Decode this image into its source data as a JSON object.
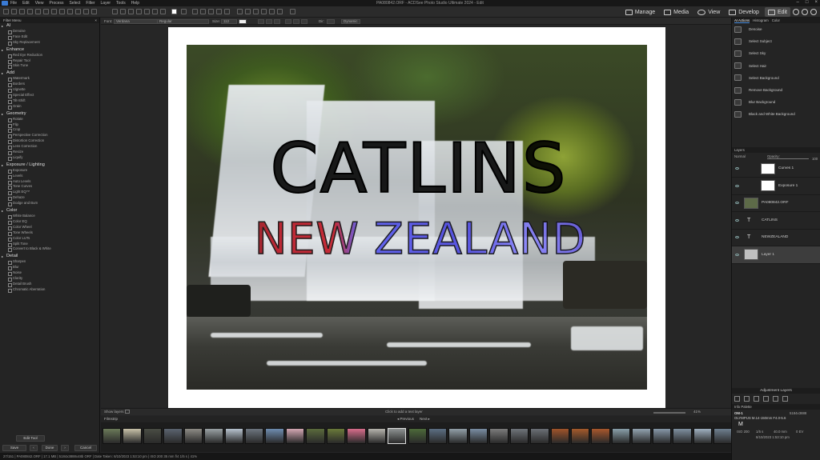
{
  "app": {
    "title": "PA080842.ORF - ACDSee Photo Studio Ultimate 2024 - Edit",
    "menu": [
      "File",
      "Edit",
      "View",
      "Process",
      "Select",
      "Filter",
      "Layer",
      "Tools",
      "Help"
    ],
    "modes": [
      {
        "label": "Manage",
        "icon": "manage-icon",
        "active": false
      },
      {
        "label": "Media",
        "icon": "media-icon",
        "active": false
      },
      {
        "label": "View",
        "icon": "eye-icon",
        "active": false
      },
      {
        "label": "Develop",
        "icon": "develop-icon",
        "active": false
      },
      {
        "label": "Edit",
        "icon": "edit-icon",
        "active": true
      }
    ]
  },
  "filter_menu": {
    "title": "Filter Menu",
    "categories": [
      {
        "name": "AI",
        "items": [
          "Denoise",
          "Face Edit",
          "Sky Replacement"
        ]
      },
      {
        "name": "Enhance",
        "items": [
          "Red Eye Reduction",
          "Repair Tool",
          "Skin Tune"
        ]
      },
      {
        "name": "Add",
        "items": [
          "Watermark",
          "Borders",
          "Vignette",
          "Special Effect",
          "Tilt-Shift",
          "Grain"
        ]
      },
      {
        "name": "Geometry",
        "items": [
          "Rotate",
          "Flip",
          "Crop",
          "Perspective Correction",
          "Distortion Correction",
          "Lens Correction",
          "Resize",
          "Liquify"
        ]
      },
      {
        "name": "Exposure / Lighting",
        "items": [
          "Exposure",
          "Levels",
          "Auto Levels",
          "Tone Curves",
          "Light EQ™",
          "Dehaze",
          "Dodge and Burn"
        ]
      },
      {
        "name": "Color",
        "items": [
          "White Balance",
          "Color EQ",
          "Color Wheel",
          "Tone Wheels",
          "Color LUTs",
          "Split Tone",
          "Convert to Black & White"
        ]
      },
      {
        "name": "Detail",
        "items": [
          "Sharpen",
          "Blur",
          "Noise",
          "Clarity",
          "Detail Brush",
          "Chromatic Aberration"
        ]
      }
    ],
    "edit_tool_label": "Edit Tool",
    "save_label": "Save",
    "done_label": "Done",
    "cancel_label": "Cancel"
  },
  "option_bar": {
    "font_label": "Font:",
    "font_value": "Verdana",
    "style_value": "Regular",
    "size_label": "Size:",
    "size_value": "112",
    "align_label": "Dir:",
    "layout_value": "Dynamic"
  },
  "canvas": {
    "headline": "CATLINS",
    "subline": "NEW ZEALAND",
    "show_layers_label": "Show layers",
    "hint": "Click to add a text layer",
    "zoom": "41%"
  },
  "filmstrip": {
    "title": "Filmstrip",
    "prev_label": "Previous",
    "next_label": "Next",
    "thumb_colors": [
      "#6b7a59",
      "#c8c2a8",
      "#4a4d44",
      "#5b6470",
      "#8e8c86",
      "#9aa2a5",
      "#b7c3cf",
      "#6d7680",
      "#6f8db0",
      "#d4a7b3",
      "#5b6b3d",
      "#6a7a3a",
      "#d86d8c",
      "#b6b4ad",
      "#8e9392",
      "#4d6a3a",
      "#5c6f83",
      "#93a0a8",
      "#7a8ea3",
      "#7c7c7c",
      "#6f747a",
      "#6b7076",
      "#a0542a",
      "#a55a2b",
      "#a8572c",
      "#8aa0aa",
      "#93a3b0",
      "#8798a8",
      "#7f90a0",
      "#9fb0c0",
      "#6f8090"
    ],
    "selected_index": 14
  },
  "ai_actions": {
    "tabs": [
      "AI Actions",
      "Histogram",
      "Color"
    ],
    "items": [
      "Denoise",
      "Select Subject",
      "Select Sky",
      "Select Hair",
      "Select Background",
      "Remove Background",
      "Blur Background",
      "Black and White Background"
    ]
  },
  "layers": {
    "title": "Layers",
    "blend": "Normal",
    "opacity_label": "Opacity:",
    "opacity_value": "100",
    "items": [
      {
        "name": "Curves 1",
        "type": "adjust"
      },
      {
        "name": "Exposure 1",
        "type": "adjust"
      },
      {
        "name": "PA080842.ORF",
        "type": "image"
      },
      {
        "name": "CATLINS",
        "type": "text"
      },
      {
        "name": "NEWZEALAND",
        "type": "text"
      },
      {
        "name": "Layer 1",
        "type": "blank",
        "selected": true
      }
    ],
    "adjustment_layers_label": "Adjustment Layers"
  },
  "info_palette": {
    "title": "Info Palette",
    "camera": "OM-1",
    "lens": "OLYMPUS M.14-150mm F4.0-5.6",
    "dims": "5184x3888",
    "mode": "M",
    "iso": "ISO 200",
    "shutter": "1/5 s",
    "focal": "40.0 mm",
    "ev": "0 EV",
    "date": "8/10/2023 1:53:10 pm"
  },
  "status": {
    "text": "27/151  |  PA080842.ORF  |  17.1 MB  |  5184x3888x48b ORF  |  Date Taken: 8/10/2023 1:53:10 pm  |  ISO 200  35 mm  f/4  1/5 s  |  41%"
  }
}
